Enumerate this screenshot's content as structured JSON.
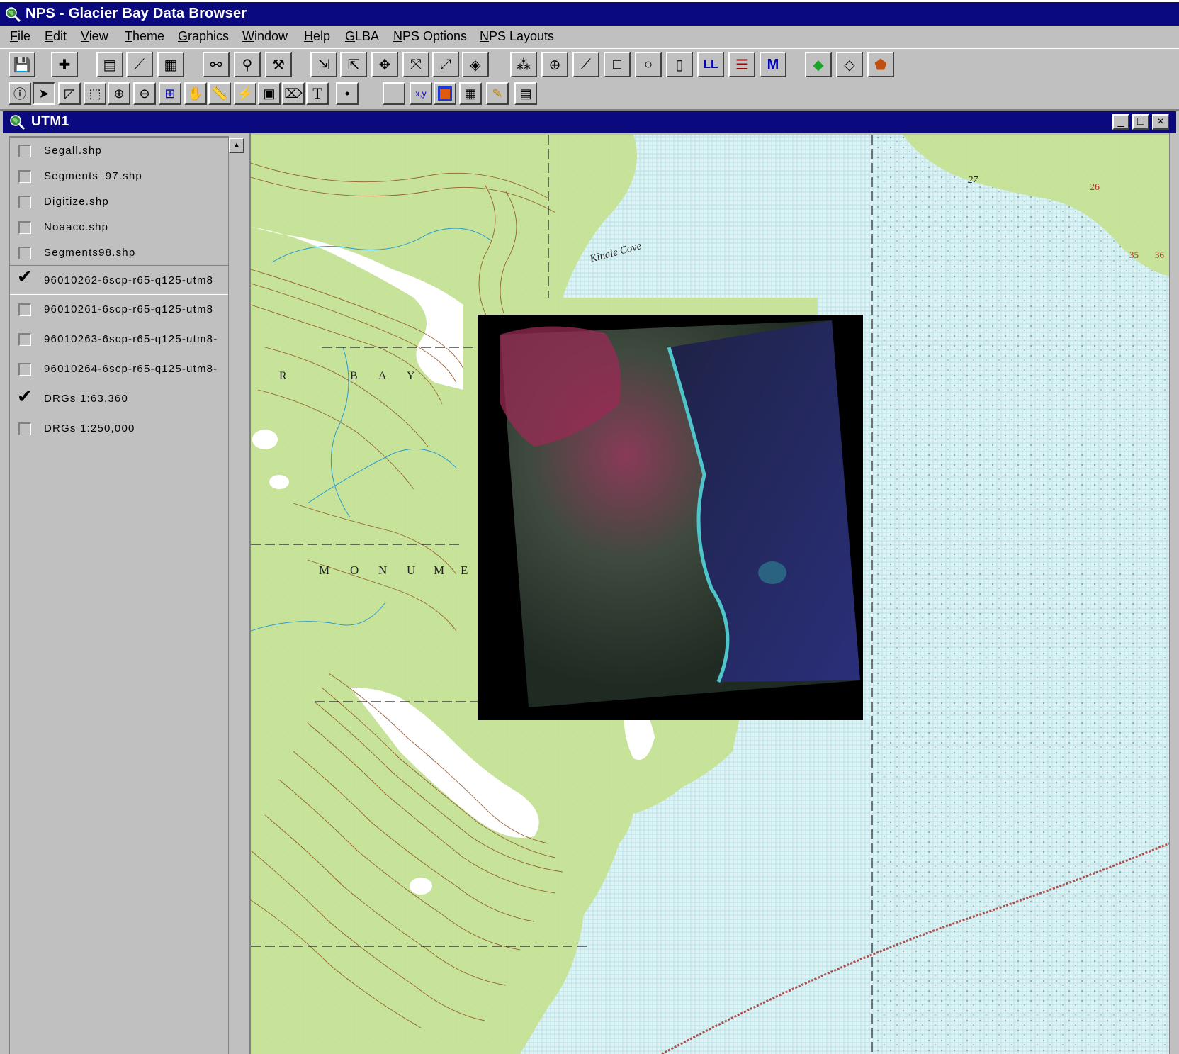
{
  "app": {
    "title": "NPS  - Glacier Bay Data Browser"
  },
  "menu": [
    "File",
    "Edit",
    "View",
    "Theme",
    "Graphics",
    "Window",
    "Help",
    "GLBA",
    "NPS Options",
    "NPS Layouts"
  ],
  "view_window": {
    "title": "UTM1",
    "minimize": "_",
    "maximize": "□",
    "close": "×"
  },
  "themes": [
    {
      "label": "Segall.shp",
      "checked": false
    },
    {
      "label": "Segments_97.shp",
      "checked": false
    },
    {
      "label": "Digitize.shp",
      "checked": false
    },
    {
      "label": "Noaacc.shp",
      "checked": false
    },
    {
      "label": "Segments98.shp",
      "checked": false
    },
    {
      "label": "96010262-6scp-r65-q125-utm8",
      "checked": true
    },
    {
      "label": "96010261-6scp-r65-q125-utm8",
      "checked": false
    },
    {
      "label": "96010263-6scp-r65-q125-utm8-",
      "checked": false
    },
    {
      "label": "96010264-6scp-r65-q125-utm8-",
      "checked": false
    },
    {
      "label": "DRGs 1:63,360",
      "checked": true
    },
    {
      "label": "DRGs 1:250,000",
      "checked": false
    }
  ],
  "colors": {
    "title_bar": "#0a0a7e",
    "land": "#c7e39a",
    "water": "#d6f0f2",
    "contour": "#8b4a1e",
    "glacier": "#ffffff",
    "imagery_bg": "#000000"
  },
  "map_labels": {
    "kinale_cove": "Kinale Cove",
    "bay_r": "R",
    "bay_b": "B",
    "bay_a": "A",
    "bay_y": "Y",
    "mon_m": "M",
    "mon_o": "O",
    "mon_n": "N",
    "mon_u": "U",
    "mon_m2": "M",
    "mon_e": "E",
    "n27": "27",
    "n26": "26",
    "n35": "35",
    "n36": "36"
  }
}
